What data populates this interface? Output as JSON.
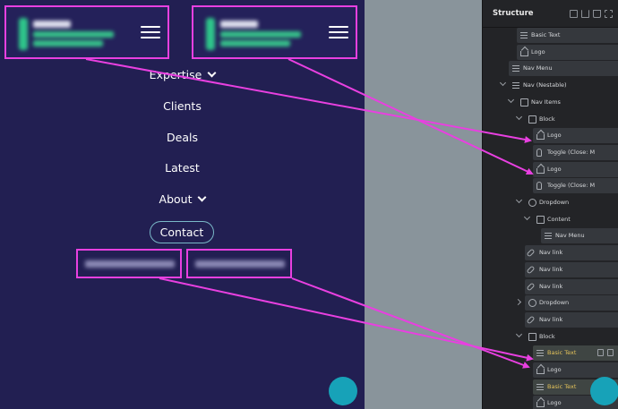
{
  "preview": {
    "nav": [
      {
        "label": "Expertise",
        "caret": true
      },
      {
        "label": "Clients",
        "caret": false
      },
      {
        "label": "Deals",
        "caret": false
      },
      {
        "label": "Latest",
        "caret": false
      },
      {
        "label": "About",
        "caret": true
      }
    ],
    "contact_label": "Contact",
    "colors": {
      "background": "#221f52",
      "highlight": "#e840e0",
      "logo_accent": "#2fc48a"
    }
  },
  "structure": {
    "title": "Structure",
    "header_icons": [
      "copy-icon",
      "download-icon",
      "trash-icon",
      "expand-icon"
    ],
    "nodes": [
      {
        "label": "Basic Text",
        "icon": "text",
        "depth": 3,
        "chevron": "none",
        "style": "box",
        "selected": false
      },
      {
        "label": "Logo",
        "icon": "home",
        "depth": 3,
        "chevron": "none",
        "style": "box",
        "selected": false
      },
      {
        "label": "Nav Menu",
        "icon": "text",
        "depth": 2,
        "chevron": "none",
        "style": "box",
        "selected": false
      },
      {
        "label": "Nav (Nestable)",
        "icon": "text",
        "depth": 2,
        "chevron": "open",
        "style": "plain",
        "selected": false
      },
      {
        "label": "Nav Items",
        "icon": "square",
        "depth": 3,
        "chevron": "open",
        "style": "plain",
        "selected": false
      },
      {
        "label": "Block",
        "icon": "square",
        "depth": 4,
        "chevron": "open",
        "style": "plain",
        "selected": false
      },
      {
        "label": "Logo",
        "icon": "home",
        "depth": 5,
        "chevron": "none",
        "style": "box",
        "selected": false
      },
      {
        "label": "Toggle (Close: M",
        "icon": "hand",
        "depth": 5,
        "chevron": "none",
        "style": "box",
        "selected": false
      },
      {
        "label": "Logo",
        "icon": "home",
        "depth": 5,
        "chevron": "none",
        "style": "box",
        "selected": false
      },
      {
        "label": "Toggle (Close: M",
        "icon": "hand",
        "depth": 5,
        "chevron": "none",
        "style": "box",
        "selected": false
      },
      {
        "label": "Dropdown",
        "icon": "circle",
        "depth": 4,
        "chevron": "open",
        "style": "plain",
        "selected": false
      },
      {
        "label": "Content",
        "icon": "square",
        "depth": 5,
        "chevron": "open",
        "style": "plain",
        "selected": false
      },
      {
        "label": "Nav Menu",
        "icon": "text",
        "depth": 6,
        "chevron": "none",
        "style": "box",
        "selected": false
      },
      {
        "label": "Nav link",
        "icon": "link",
        "depth": 4,
        "chevron": "none",
        "style": "box",
        "selected": false
      },
      {
        "label": "Nav link",
        "icon": "link",
        "depth": 4,
        "chevron": "none",
        "style": "box",
        "selected": false
      },
      {
        "label": "Nav link",
        "icon": "link",
        "depth": 4,
        "chevron": "none",
        "style": "box",
        "selected": false
      },
      {
        "label": "Dropdown",
        "icon": "circle",
        "depth": 4,
        "chevron": "closed",
        "style": "box",
        "selected": false
      },
      {
        "label": "Nav link",
        "icon": "link",
        "depth": 4,
        "chevron": "none",
        "style": "box",
        "selected": false
      },
      {
        "label": "Block",
        "icon": "square",
        "depth": 4,
        "chevron": "open",
        "style": "plain",
        "selected": false
      },
      {
        "label": "Basic Text",
        "icon": "text",
        "depth": 5,
        "chevron": "none",
        "style": "box",
        "selected": true
      },
      {
        "label": "Logo",
        "icon": "home",
        "depth": 5,
        "chevron": "none",
        "style": "box",
        "selected": false
      },
      {
        "label": "Basic Text",
        "icon": "text",
        "depth": 5,
        "chevron": "none",
        "style": "box",
        "selected": true
      },
      {
        "label": "Logo",
        "icon": "home",
        "depth": 5,
        "chevron": "none",
        "style": "box",
        "selected": false
      }
    ]
  }
}
